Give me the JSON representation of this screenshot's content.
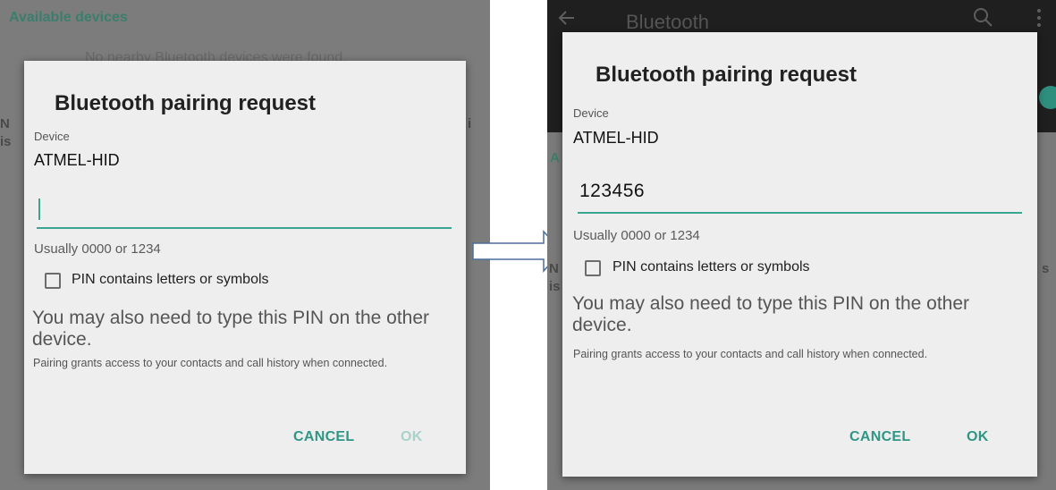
{
  "colors": {
    "accent": "#2f9685",
    "accent_line": "#3aa692",
    "accent_disabled": "#a9d2ca",
    "dialog_bg": "#eeeeee",
    "scrim": "#7a7a7a",
    "appbar": "#1f1f1f"
  },
  "left": {
    "background": {
      "heading": "Available devices",
      "faint_text": "No nearby Bluetooth devices were found.",
      "edge_letters": [
        "N",
        "is",
        "i"
      ]
    },
    "dialog": {
      "title": "Bluetooth pairing request",
      "device_label": "Device",
      "device_name": "ATMEL-HID",
      "pin_value": "",
      "pin_hint": "Usually 0000 or 1234",
      "checkbox_label": "PIN contains letters or symbols",
      "checkbox_checked": false,
      "message": "You may also need to type this PIN on the other device.",
      "note": "Pairing grants access to your contacts and call history when connected.",
      "cancel_label": "CANCEL",
      "ok_label": "OK",
      "ok_enabled": false
    }
  },
  "right": {
    "background": {
      "appbar_title": "Bluetooth",
      "back_icon": "arrow-back-icon",
      "search_icon": "search-icon",
      "more_icon": "more-vert-icon",
      "edge_letters": [
        "A",
        "N",
        "is",
        "s"
      ]
    },
    "dialog": {
      "title": "Bluetooth pairing request",
      "device_label": "Device",
      "device_name": "ATMEL-HID",
      "pin_value": "123456",
      "pin_hint": "Usually 0000 or 1234",
      "checkbox_label": "PIN contains letters or symbols",
      "checkbox_checked": false,
      "message": "You may also need to type this PIN on the other device.",
      "note": "Pairing grants access to your contacts and call history when connected.",
      "cancel_label": "CANCEL",
      "ok_label": "OK",
      "ok_enabled": true
    }
  },
  "arrow_icon": "right-arrow-icon"
}
